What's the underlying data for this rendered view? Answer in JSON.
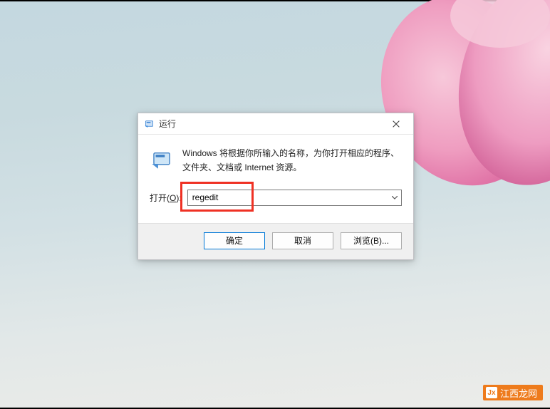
{
  "dialog": {
    "title": "运行",
    "description": "Windows 将根据你所输入的名称，为你打开相应的程序、文件夹、文档或 Internet 资源。",
    "open_label_prefix": "打开(",
    "open_label_accel": "O",
    "open_label_suffix": "):",
    "input_value": "regedit",
    "ok_label": "确定",
    "cancel_label": "取消",
    "browse_label": "浏览(B)..."
  },
  "watermark": {
    "text": "江西龙网"
  }
}
